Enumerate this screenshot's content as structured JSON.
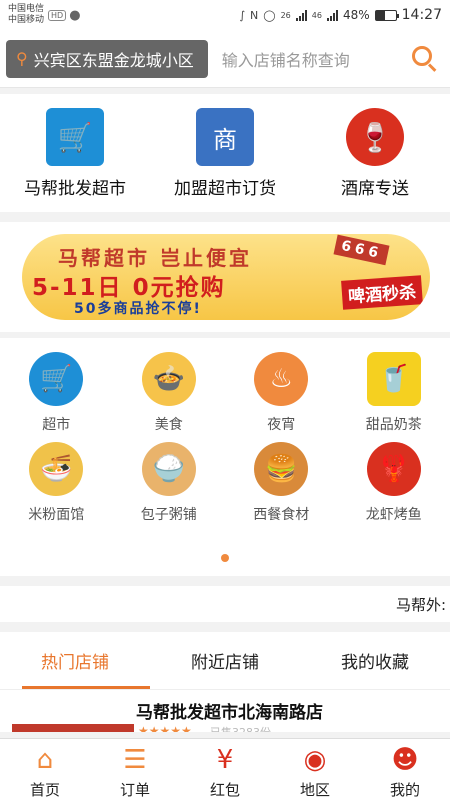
{
  "status_bar": {
    "carrier1": "中国电信",
    "carrier2": "中国移动",
    "hd_badge": "HD",
    "network1": "26",
    "network2": "46",
    "battery": "48%",
    "battery_level": 0.48,
    "time": "14:27"
  },
  "search": {
    "location": "兴宾区东盟金龙城小区",
    "placeholder": "输入店铺名称查询"
  },
  "top_categories": [
    {
      "label": "马帮批发超市",
      "icon": "cart-icon",
      "color": "#1e8fd6"
    },
    {
      "label": "加盟超市订货",
      "icon": "shop-badge-icon",
      "color": "#3a72c2"
    },
    {
      "label": "酒席专送",
      "icon": "wine-icon",
      "color": "#d9301f"
    }
  ],
  "banner": {
    "line1": "马帮超市 岂止便宜",
    "line2": "5-11日 0元抢购",
    "line3": "50多商品抢不停!",
    "tag": "啤酒秒杀",
    "cards": "666"
  },
  "grid": {
    "row1": [
      {
        "label": "超市",
        "icon": "cart-icon",
        "color": "#1e8fd6"
      },
      {
        "label": "美食",
        "icon": "food-basket-icon",
        "color": "#f6c34a"
      },
      {
        "label": "夜宵",
        "icon": "bowl-icon",
        "color": "#f08a3e"
      },
      {
        "label": "甜品奶茶",
        "icon": "milk-tea-icon",
        "color": "#f5d020"
      }
    ],
    "row2": [
      {
        "label": "米粉面馆",
        "icon": "noodle-bowl-icon",
        "color": "#f0c24a"
      },
      {
        "label": "包子粥铺",
        "icon": "steamer-icon",
        "color": "#e9b36b"
      },
      {
        "label": "西餐食材",
        "icon": "burger-icon",
        "color": "#d98a3a"
      },
      {
        "label": "龙虾烤鱼",
        "icon": "crawfish-icon",
        "color": "#d9301f"
      }
    ]
  },
  "marquee_text": "马帮外:",
  "tabs": [
    {
      "label": "热门店铺",
      "active": true
    },
    {
      "label": "附近店铺",
      "active": false
    },
    {
      "label": "我的收藏",
      "active": false
    }
  ],
  "store": {
    "name": "马帮批发超市北海南路店",
    "rating_stars": "★★★★★",
    "sales": "已售3283份"
  },
  "bottom_nav": [
    {
      "label": "首页",
      "icon": "home-icon",
      "color": "#f08a3e"
    },
    {
      "label": "订单",
      "icon": "orders-icon",
      "color": "#f08a3e"
    },
    {
      "label": "红包",
      "icon": "red-packet-icon",
      "color": "#d9301f"
    },
    {
      "label": "地区",
      "icon": "location-icon",
      "color": "#d9301f"
    },
    {
      "label": "我的",
      "icon": "user-icon",
      "color": "#d9301f"
    }
  ]
}
